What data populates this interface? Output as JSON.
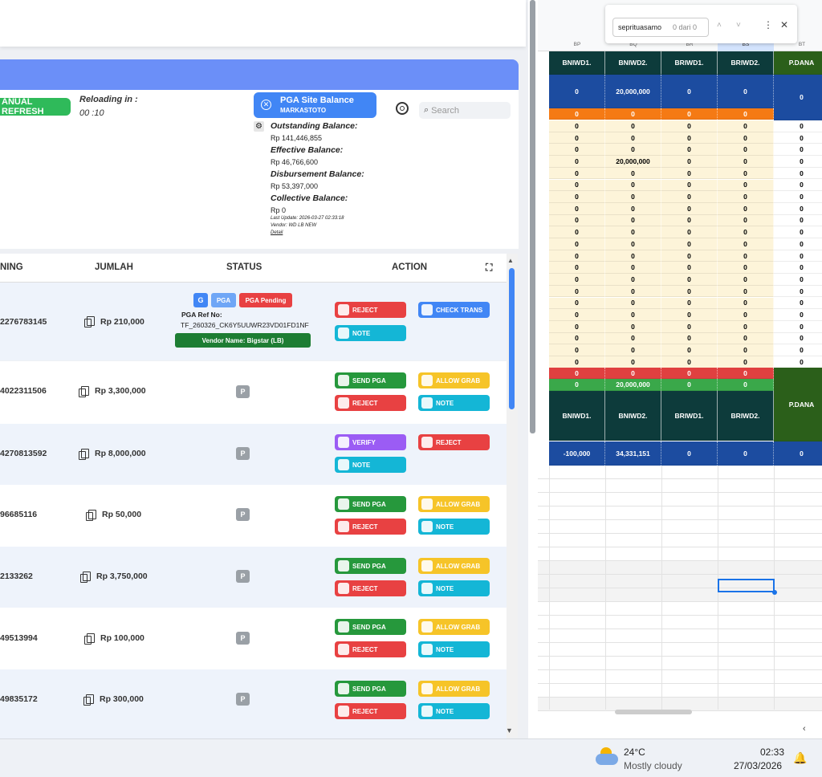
{
  "left": {
    "manual_refresh": "ANUAL REFRESH",
    "reloading_label": "Reloading in :",
    "reloading_value": "00 :10",
    "pga_site_balance": "PGA Site Balance",
    "pga_site_name": "MARKASTOTO",
    "search_placeholder": "Search",
    "balances": [
      {
        "label": "Outstanding Balance:",
        "value": "Rp 141,446,855"
      },
      {
        "label": "Effective Balance:",
        "value": "Rp 46,766,600"
      },
      {
        "label": "Disbursement Balance:",
        "value": "Rp 53,397,000"
      },
      {
        "label": "Collective Balance:",
        "value": "Rp 0"
      }
    ],
    "last_update": "Last Update: 2026-03-27 02:33:18",
    "vendor": "Vendor: WD LB NEW",
    "detail": "Detail",
    "headers": {
      "account": "NING",
      "jumlah": "JUMLAH",
      "status": "STATUS",
      "action": "ACTION"
    },
    "first_row": {
      "badges": [
        "G",
        "PGA",
        "PGA Pending"
      ],
      "ref_label": "PGA Ref No:",
      "ref_value": "TF_260326_CK6Y5UUWR23VD01FD1NF",
      "vendor_name": "Vendor Name: Bigstar (LB)"
    },
    "rows": [
      {
        "account": "2276783145",
        "amount": "Rp 210,000",
        "status": "",
        "buttons": [
          "REJECT",
          "CHECK TRANS",
          "NOTE"
        ]
      },
      {
        "account": "4022311506",
        "amount": "Rp 3,300,000",
        "status": "P",
        "buttons": [
          "SEND PGA",
          "ALLOW GRAB",
          "REJECT",
          "NOTE"
        ]
      },
      {
        "account": "4270813592",
        "amount": "Rp 8,000,000",
        "status": "P",
        "buttons": [
          "VERIFY",
          "REJECT",
          "NOTE"
        ]
      },
      {
        "account": "96685116",
        "amount": "Rp 50,000",
        "status": "P",
        "buttons": [
          "SEND PGA",
          "ALLOW GRAB",
          "REJECT",
          "NOTE"
        ]
      },
      {
        "account": "2133262",
        "amount": "Rp 3,750,000",
        "status": "P",
        "buttons": [
          "SEND PGA",
          "ALLOW GRAB",
          "REJECT",
          "NOTE"
        ]
      },
      {
        "account": "49513994",
        "amount": "Rp 100,000",
        "status": "P",
        "buttons": [
          "SEND PGA",
          "ALLOW GRAB",
          "REJECT",
          "NOTE"
        ]
      },
      {
        "account": "49835172",
        "amount": "Rp 300,000",
        "status": "P",
        "buttons": [
          "SEND PGA",
          "ALLOW GRAB",
          "REJECT",
          "NOTE"
        ]
      }
    ]
  },
  "sheet": {
    "find_text": "sepritua​samo",
    "find_count": "0 dari 0",
    "col_letters": [
      "BP",
      "BQ",
      "BR",
      "BS",
      "BT"
    ],
    "header_row": [
      "BNIWD1.",
      "BNIWD2.",
      "BRIWD1.",
      "BRIWD2.",
      "P.DANA"
    ],
    "top_totals": [
      "0",
      "20,000,000",
      "0",
      "0",
      "0"
    ],
    "orange_row": [
      "0",
      "0",
      "0",
      "0"
    ],
    "data_rows": [
      [
        "0",
        "0",
        "0",
        "0",
        "0"
      ],
      [
        "0",
        "0",
        "0",
        "0",
        "0"
      ],
      [
        "0",
        "0",
        "0",
        "0",
        "0"
      ],
      [
        "0",
        "20,000,000",
        "0",
        "0",
        "0"
      ],
      [
        "0",
        "0",
        "0",
        "0",
        "0"
      ],
      [
        "0",
        "0",
        "0",
        "0",
        "0"
      ],
      [
        "0",
        "0",
        "0",
        "0",
        "0"
      ],
      [
        "0",
        "0",
        "0",
        "0",
        "0"
      ],
      [
        "0",
        "0",
        "0",
        "0",
        "0"
      ],
      [
        "0",
        "0",
        "0",
        "0",
        "0"
      ],
      [
        "0",
        "0",
        "0",
        "0",
        "0"
      ],
      [
        "0",
        "0",
        "0",
        "0",
        "0"
      ],
      [
        "0",
        "0",
        "0",
        "0",
        "0"
      ],
      [
        "0",
        "0",
        "0",
        "0",
        "0"
      ],
      [
        "0",
        "0",
        "0",
        "0",
        "0"
      ],
      [
        "0",
        "0",
        "0",
        "0",
        "0"
      ],
      [
        "0",
        "0",
        "0",
        "0",
        "0"
      ],
      [
        "0",
        "0",
        "0",
        "0",
        "0"
      ],
      [
        "0",
        "0",
        "0",
        "0",
        "0"
      ],
      [
        "0",
        "0",
        "0",
        "0",
        "0"
      ],
      [
        "0",
        "0",
        "0",
        "0",
        "0"
      ]
    ],
    "red_row": [
      "0",
      "0",
      "0",
      "0"
    ],
    "green_row": [
      "0",
      "20,000,000",
      "0",
      "0"
    ],
    "bottom_header": [
      "BNIWD1.",
      "BNIWD2.",
      "BRIWD1.",
      "BRIWD2.",
      "P.DANA"
    ],
    "bottom_totals": [
      "-100,000",
      "34,331,151",
      "0",
      "0",
      "0"
    ]
  },
  "taskbar": {
    "temp": "24°C",
    "weather": "Mostly cloudy",
    "time": "02:33",
    "date": "27/03/2026"
  }
}
